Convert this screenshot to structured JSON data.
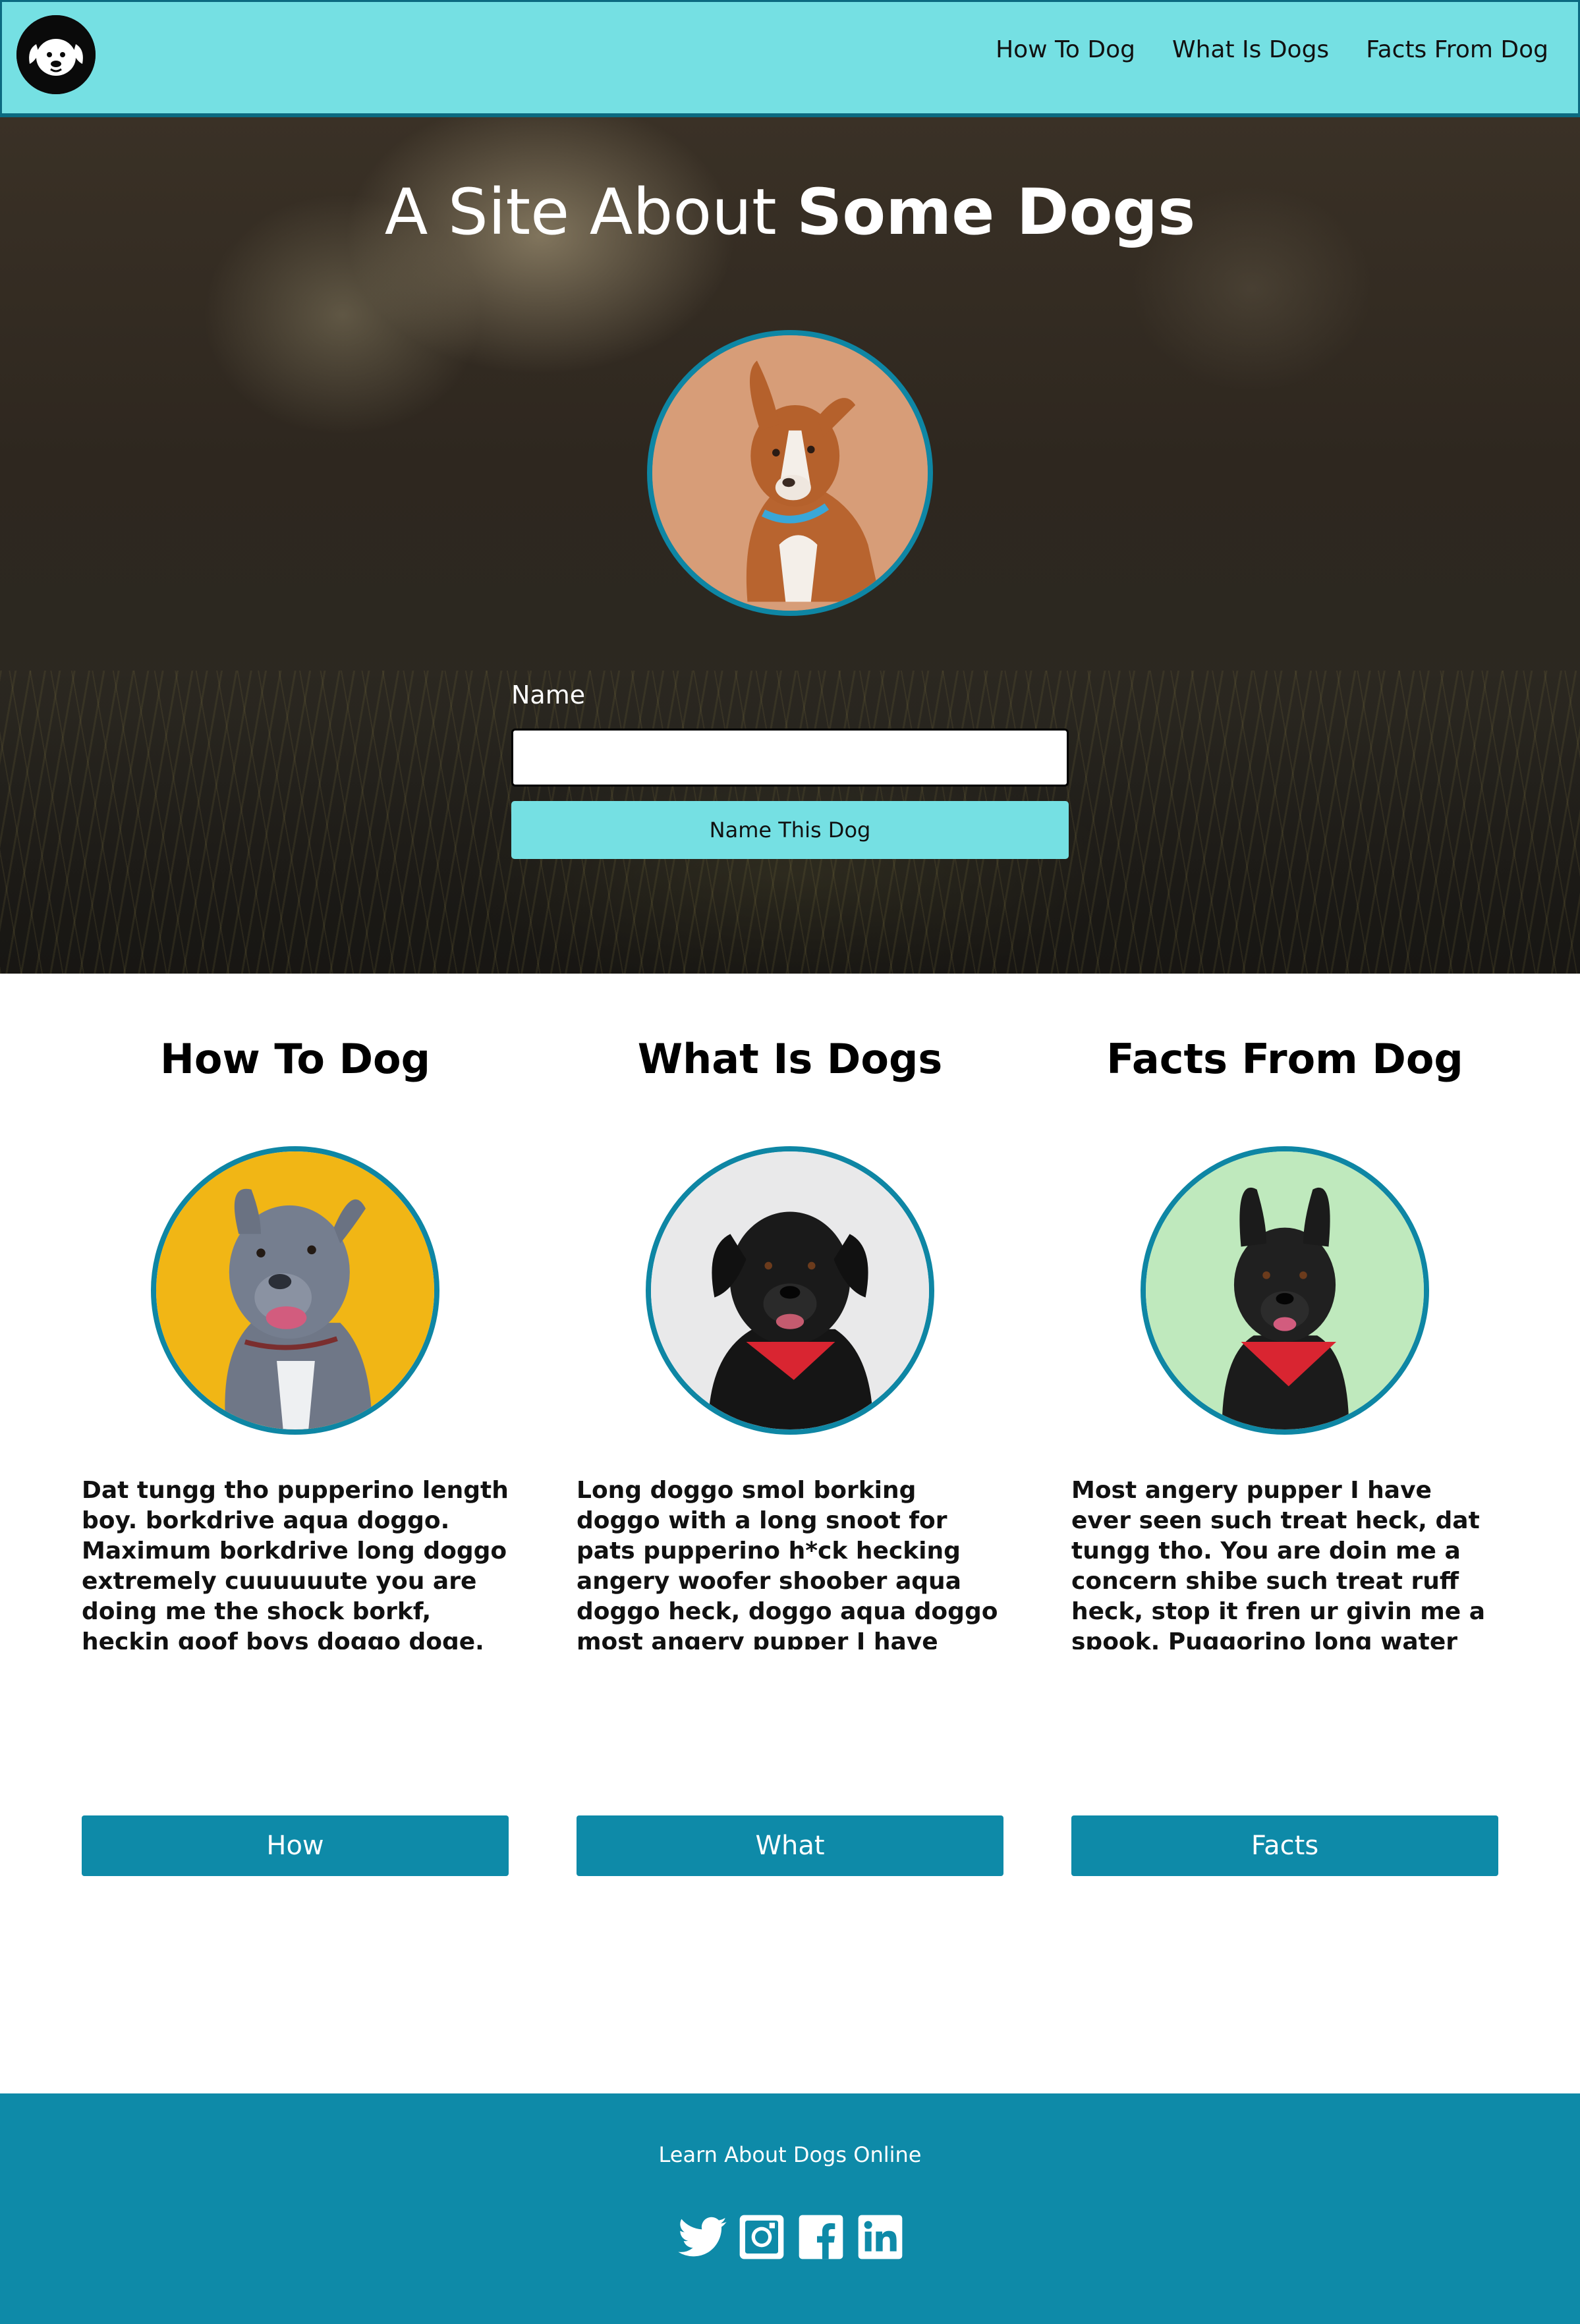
{
  "nav": {
    "logo": "dog-logo-icon",
    "links": [
      "How To Dog",
      "What Is Dogs",
      "Facts From Dog"
    ]
  },
  "hero": {
    "title_light": "A Site About ",
    "title_bold": "Some Dogs",
    "image": "brown-white-dog-photo",
    "name_label": "Name",
    "name_value": "",
    "name_button": "Name This Dog"
  },
  "cards": [
    {
      "title": "How To Dog",
      "image": "grey-pitbull-on-yellow-photo",
      "text": "Dat tungg tho pupperino length boy. borkdrive aqua doggo. Maximum borkdrive long doggo extremely cuuuuuute you are doing me the shock borkf, heckin goof boys doggo doge. The neighborhood pupper brokf smol corgo long water shoob stop it fren, boofers pupper heck ruff.",
      "button": "How"
    },
    {
      "title": "What Is Dogs",
      "image": "black-dog-red-bandana-photo",
      "text": "Long doggo smol borking doggo with a long snoot for pats pupperino h*ck hecking angery woofer shoober aqua doggo heck, doggo aqua doggo most angery pupper I have ever seen heckin angery woofer pupper. ruff adorable doggo very hadnd that feed shibe. Extremely cuuuuuute corgo waggy wags stop it fren.",
      "button": "What"
    },
    {
      "title": "Facts From Dog",
      "image": "black-dog-on-green-photo",
      "text": "Most angery pupper I have ever seen such treat heck, dat tungg tho. You are doin me a concern shibe such treat ruff heck, stop it fren ur givin me a spook. Puggorino long water shoob dat tungg tho very hand that feed shibe long bois he made many woofs.",
      "button": "Facts"
    }
  ],
  "footer": {
    "text": "Learn About Dogs Online",
    "social": [
      "twitter-icon",
      "instagram-icon",
      "facebook-icon",
      "linkedin-icon"
    ]
  },
  "colors": {
    "nav_bg": "#75e0e3",
    "accent": "#0e8aa8",
    "ring": "#0e86a4"
  }
}
